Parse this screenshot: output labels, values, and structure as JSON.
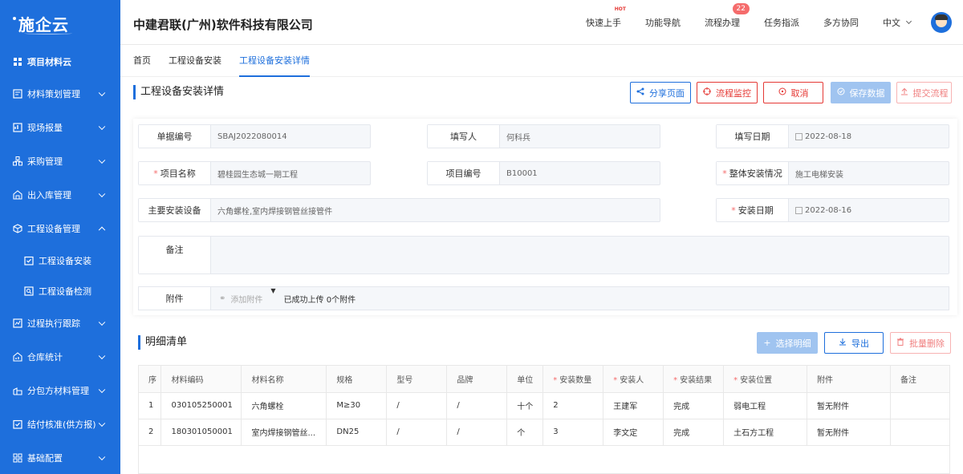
{
  "brand": {
    "logo": "施企云"
  },
  "sidebar": {
    "top": "项目材料云",
    "items": [
      {
        "label": "材料策划管理",
        "icon": "plan-icon"
      },
      {
        "label": "现场报量",
        "icon": "report-icon"
      },
      {
        "label": "采购管理",
        "icon": "purchase-icon"
      },
      {
        "label": "出入库管理",
        "icon": "warehouse-icon"
      },
      {
        "label": "工程设备管理",
        "icon": "cube-icon",
        "expanded": true
      }
    ],
    "sub": [
      {
        "label": "工程设备安装",
        "icon": "check-doc-icon"
      },
      {
        "label": "工程设备检测",
        "icon": "scan-doc-icon"
      }
    ],
    "items2": [
      {
        "label": "过程执行跟踪",
        "icon": "track-icon"
      },
      {
        "label": "仓库统计",
        "icon": "stats-icon"
      },
      {
        "label": "分包方材料管理",
        "icon": "subcontract-icon"
      },
      {
        "label": "结付核准(供方报)",
        "icon": "settle-icon"
      },
      {
        "label": "基础配置",
        "icon": "grid-icon"
      }
    ]
  },
  "header": {
    "company": "中建君联(广州)软件科技有限公司",
    "nav": [
      "快速上手",
      "功能导航",
      "流程办理",
      "任务指派",
      "多方协同"
    ],
    "hot": "HOT",
    "badge": "22",
    "lang": "中文"
  },
  "tabs": [
    "首页",
    "工程设备安装",
    "工程设备安装详情"
  ],
  "section_title": "工程设备安装详情",
  "buttons": {
    "share": "分享页面",
    "monitor": "流程监控",
    "cancel": "取消",
    "save": "保存数据",
    "submit": "提交流程"
  },
  "form": {
    "doc_no": {
      "label": "单据编号",
      "value": "SBAJ2022080014"
    },
    "filler": {
      "label": "填写人",
      "value": "何科兵"
    },
    "fill_date": {
      "label": "填写日期",
      "value": "2022-08-18"
    },
    "project_name": {
      "label": "项目名称",
      "value": "碧桂园生态城一期工程"
    },
    "project_no": {
      "label": "项目编号",
      "value": "B10001"
    },
    "install_status": {
      "label": "整体安装情况",
      "value": "施工电梯安装"
    },
    "main_equipment": {
      "label": "主要安装设备",
      "value": "六角螺栓,室内焊接钢管丝接管件"
    },
    "install_date": {
      "label": "安装日期",
      "value": "2022-08-16"
    },
    "remark": {
      "label": "备注",
      "value": ""
    },
    "attachment": {
      "label": "附件",
      "add": "添加附件",
      "status": "已成功上传 0个附件"
    }
  },
  "detail_title": "明细清单",
  "detail_buttons": {
    "select": "选择明细",
    "export": "导出",
    "batch_delete": "批量删除"
  },
  "table": {
    "headers": [
      "序",
      "材料编码",
      "材料名称",
      "规格",
      "型号",
      "品牌",
      "单位",
      "安装数量",
      "安装人",
      "安装结果",
      "安装位置",
      "附件",
      "备注"
    ],
    "required": [
      7,
      8,
      9,
      10
    ],
    "rows": [
      [
        "1",
        "030105250001",
        "六角螺栓",
        "M≥30",
        "/",
        "/",
        "十个",
        "2",
        "王建军",
        "完成",
        "弱电工程",
        "暂无附件",
        ""
      ],
      [
        "2",
        "180301050001",
        "室内焊接钢管丝...",
        "DN25",
        "/",
        "/",
        "个",
        "3",
        "李文定",
        "完成",
        "土石方工程",
        "暂无附件",
        ""
      ]
    ]
  }
}
